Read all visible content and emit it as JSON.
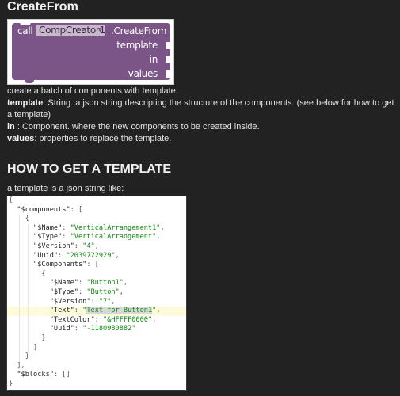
{
  "section1": {
    "title": "CreateFrom",
    "block": {
      "call_label": "call",
      "component": "CompCreator1",
      "method": ".CreateFrom",
      "params": [
        "template",
        "in",
        "values"
      ]
    },
    "description": "create a batch of components with template.",
    "params_doc": [
      {
        "name": "template",
        "sep": ":",
        "text": " String. a json string descripting the structure of the components. (see below for how to get a template)"
      },
      {
        "name": "in",
        "sep": " :",
        "text": " Component. where the new components to be created inside."
      },
      {
        "name": "values",
        "sep": ":",
        "text": " properties to replace the template."
      }
    ]
  },
  "section2": {
    "title": "HOW TO GET A TEMPLATE",
    "intro": "a template is a json string like:",
    "code_lines": [
      {
        "indent": 0,
        "parts": [
          [
            "p",
            "{"
          ]
        ]
      },
      {
        "indent": 1,
        "parts": [
          [
            "k",
            "\"$components\""
          ],
          [
            "p",
            ": ["
          ]
        ]
      },
      {
        "indent": 2,
        "parts": [
          [
            "p",
            "{"
          ]
        ]
      },
      {
        "indent": 3,
        "parts": [
          [
            "k",
            "\"$Name\""
          ],
          [
            "p",
            ": "
          ],
          [
            "s",
            "\"VerticalArrangement1\""
          ],
          [
            "p",
            ","
          ]
        ]
      },
      {
        "indent": 3,
        "parts": [
          [
            "k",
            "\"$Type\""
          ],
          [
            "p",
            ": "
          ],
          [
            "s",
            "\"VerticalArrangement\""
          ],
          [
            "p",
            ","
          ]
        ]
      },
      {
        "indent": 3,
        "parts": [
          [
            "k",
            "\"$Version\""
          ],
          [
            "p",
            ": "
          ],
          [
            "s",
            "\"4\""
          ],
          [
            "p",
            ","
          ]
        ]
      },
      {
        "indent": 3,
        "parts": [
          [
            "k",
            "\"Uuid\""
          ],
          [
            "p",
            ": "
          ],
          [
            "s",
            "\"2039722929\""
          ],
          [
            "p",
            ","
          ]
        ]
      },
      {
        "indent": 3,
        "parts": [
          [
            "k",
            "\"$Components\""
          ],
          [
            "p",
            ": ["
          ]
        ]
      },
      {
        "indent": 4,
        "parts": [
          [
            "p",
            "{"
          ]
        ]
      },
      {
        "indent": 5,
        "parts": [
          [
            "k",
            "\"$Name\""
          ],
          [
            "p",
            ": "
          ],
          [
            "s",
            "\"Button1\""
          ],
          [
            "p",
            ","
          ]
        ]
      },
      {
        "indent": 5,
        "parts": [
          [
            "k",
            "\"$Type\""
          ],
          [
            "p",
            ": "
          ],
          [
            "s",
            "\"Button\""
          ],
          [
            "p",
            ","
          ]
        ]
      },
      {
        "indent": 5,
        "parts": [
          [
            "k",
            "\"$Version\""
          ],
          [
            "p",
            ": "
          ],
          [
            "s",
            "\"7\""
          ],
          [
            "p",
            ","
          ]
        ]
      },
      {
        "indent": 5,
        "highlight": true,
        "parts": [
          [
            "k",
            "\"Text\""
          ],
          [
            "p",
            ": "
          ],
          [
            "s",
            "\""
          ],
          [
            "sel",
            "Text for Button1"
          ],
          [
            "s",
            "\""
          ],
          [
            "p",
            ","
          ]
        ]
      },
      {
        "indent": 5,
        "parts": [
          [
            "k",
            "\"TextColor\""
          ],
          [
            "p",
            ": "
          ],
          [
            "s",
            "\"&HFFFF0000\""
          ],
          [
            "p",
            ","
          ]
        ]
      },
      {
        "indent": 5,
        "parts": [
          [
            "k",
            "\"Uuid\""
          ],
          [
            "p",
            ": "
          ],
          [
            "s",
            "\"-1180980882\""
          ]
        ]
      },
      {
        "indent": 4,
        "parts": [
          [
            "p",
            "}"
          ]
        ]
      },
      {
        "indent": 3,
        "parts": [
          [
            "p",
            "]"
          ]
        ]
      },
      {
        "indent": 2,
        "parts": [
          [
            "p",
            "}"
          ]
        ]
      },
      {
        "indent": 1,
        "parts": [
          [
            "p",
            "],"
          ]
        ]
      },
      {
        "indent": 1,
        "parts": [
          [
            "k",
            "\"$blocks\""
          ],
          [
            "p",
            ": []"
          ]
        ]
      },
      {
        "indent": 0,
        "parts": [
          [
            "p",
            "}"
          ]
        ]
      }
    ]
  }
}
